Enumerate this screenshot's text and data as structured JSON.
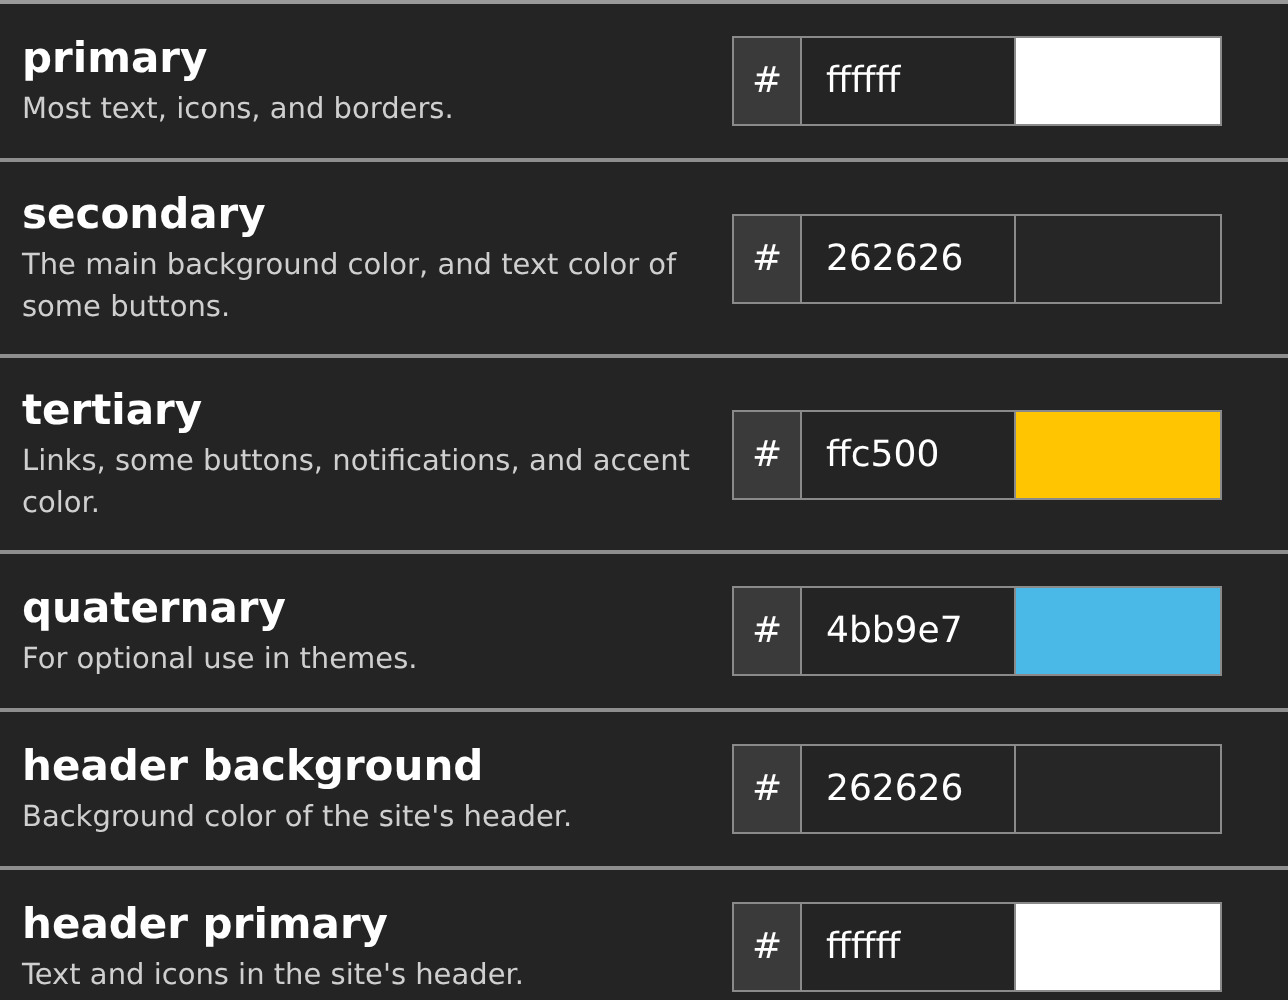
{
  "settings": [
    {
      "name": "primary",
      "description": "Most text, icons, and borders.",
      "hash": "#",
      "value": "ffffff",
      "color": "#ffffff"
    },
    {
      "name": "secondary",
      "description": "The main background color, and text color of some buttons.",
      "hash": "#",
      "value": "262626",
      "color": "#262626"
    },
    {
      "name": "tertiary",
      "description": "Links, some buttons, notifications, and accent color.",
      "hash": "#",
      "value": "ffc500",
      "color": "#ffc500"
    },
    {
      "name": "quaternary",
      "description": "For optional use in themes.",
      "hash": "#",
      "value": "4bb9e7",
      "color": "#4bb9e7"
    },
    {
      "name": "header background",
      "description": "Background color of the site's header.",
      "hash": "#",
      "value": "262626",
      "color": "#262626"
    },
    {
      "name": "header primary",
      "description": "Text and icons in the site's header.",
      "hash": "#",
      "value": "ffffff",
      "color": "#ffffff"
    }
  ]
}
